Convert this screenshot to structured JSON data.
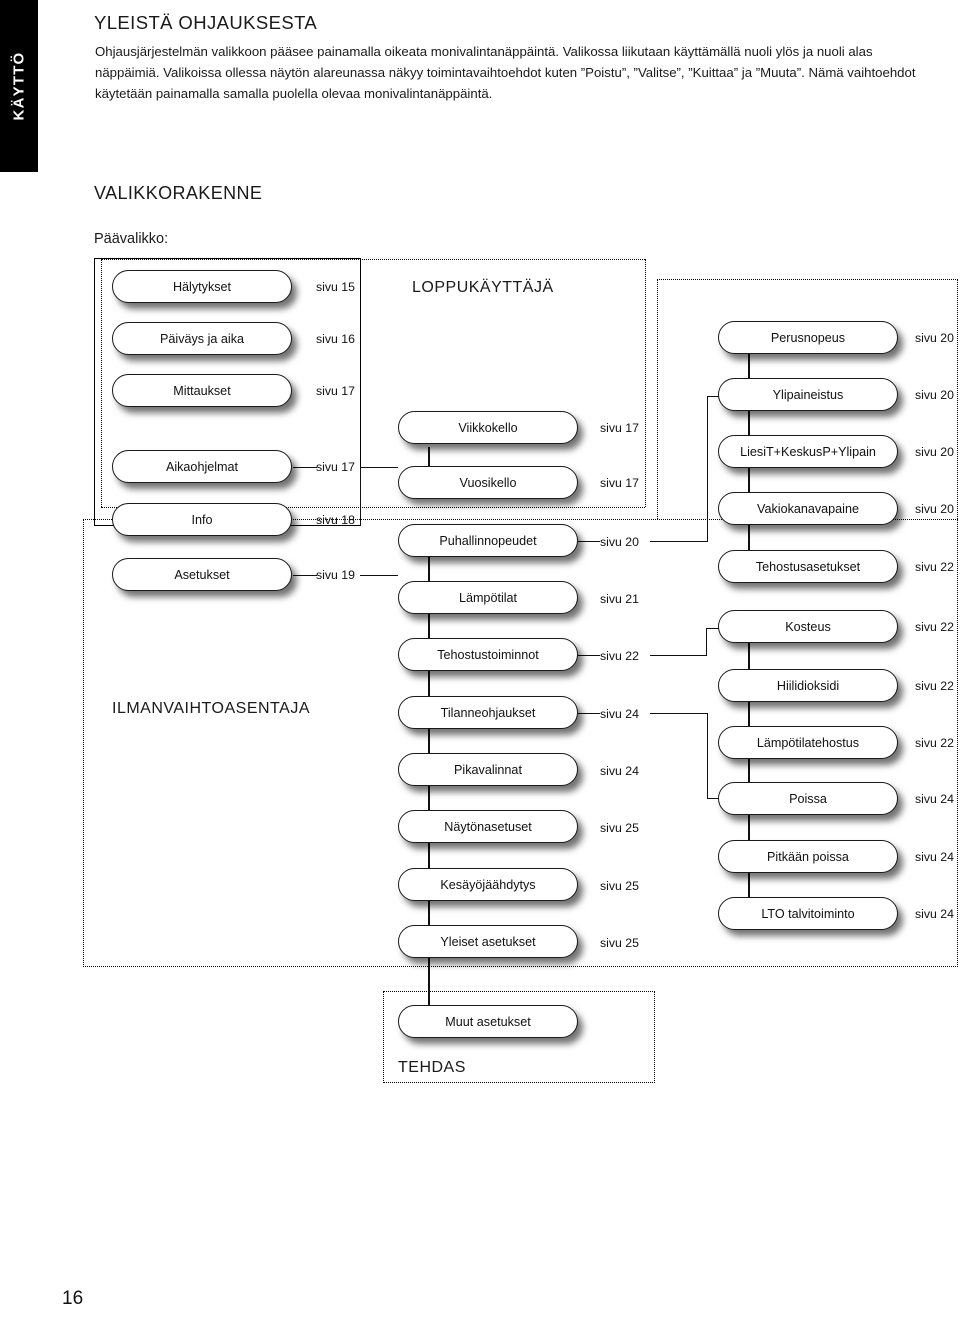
{
  "side_tab": {
    "label": "KÄYTTÖ"
  },
  "headings": {
    "section_title": "YLEISTÄ OHJAUKSESTA",
    "diagram_title": "VALIKKORAKENNE",
    "main_menu_label": "Päävalikko:"
  },
  "intro_paragraph": "Ohjausjärjestelmän valikkoon pääsee painamalla oikeata monivalintanäppäintä. Valikossa liikutaan käyttämällä nuoli ylös ja nuoli alas näppäimiä. Valikoissa ollessa näytön alareunassa näkyy toimintavaihtoehdot kuten ”Poistu”, ”Valitse”, ”Kuittaa” ja ”Muuta”. Nämä vaihtoehdot käytetään painamalla samalla puolella olevaa monivalintanäppäintä.",
  "zones": {
    "end_user": "LOPPUKÄYTTÄJÄ",
    "installer": "ILMANVAIHTOASENTAJA",
    "factory": "TEHDAS"
  },
  "page_number": "16",
  "diagram": {
    "column_main": [
      {
        "label": "Hälytykset",
        "page_ref": "sivu 15"
      },
      {
        "label": "Päiväys ja aika",
        "page_ref": "sivu 16"
      },
      {
        "label": "Mittaukset",
        "page_ref": "sivu 17"
      },
      {
        "label": "Aikaohjelmat",
        "page_ref": "sivu 17"
      },
      {
        "label": "Info",
        "page_ref": "sivu 18"
      },
      {
        "label": "Asetukset",
        "page_ref": "sivu 19"
      }
    ],
    "column_sub": [
      {
        "label": "Viikkokello",
        "page_ref": "sivu 17"
      },
      {
        "label": "Vuosikello",
        "page_ref": "sivu 17"
      },
      {
        "label": "Puhallinnopeudet",
        "page_ref": "sivu 20"
      },
      {
        "label": "Lämpötilat",
        "page_ref": "sivu 21"
      },
      {
        "label": "Tehostustoiminnot",
        "page_ref": "sivu 22"
      },
      {
        "label": "Tilanneohjaukset",
        "page_ref": "sivu 24"
      },
      {
        "label": "Pikavalinnat",
        "page_ref": "sivu 24"
      },
      {
        "label": "Näytönasetuset",
        "page_ref": "sivu 25"
      },
      {
        "label": "Kesäyöjäähdytys",
        "page_ref": "sivu 25"
      },
      {
        "label": "Yleiset asetukset",
        "page_ref": "sivu 25"
      }
    ],
    "column_detail": [
      {
        "label": "Perusnopeus",
        "page_ref": "sivu 20"
      },
      {
        "label": "Ylipaineistus",
        "page_ref": "sivu 20"
      },
      {
        "label": "LiesiT+KeskusP+Ylipain",
        "page_ref": "sivu 20"
      },
      {
        "label": "Vakiokanavapaine",
        "page_ref": "sivu 20"
      },
      {
        "label": "Tehostusasetukset",
        "page_ref": "sivu 22"
      },
      {
        "label": "Kosteus",
        "page_ref": "sivu 22"
      },
      {
        "label": "Hiilidioksidi",
        "page_ref": "sivu 22"
      },
      {
        "label": "Lämpötilatehostus",
        "page_ref": "sivu 22"
      },
      {
        "label": "Poissa",
        "page_ref": "sivu 24"
      },
      {
        "label": "Pitkään poissa",
        "page_ref": "sivu 24"
      },
      {
        "label": "LTO talvitoiminto",
        "page_ref": "sivu 24"
      }
    ],
    "column_factory": [
      {
        "label": "Muut asetukset",
        "page_ref": ""
      }
    ]
  },
  "colors": {
    "tab_background": "#000000",
    "tab_text": "#ffffff",
    "text": "#1a1a1a",
    "node_fill": "#ffffff",
    "node_border": "#1a1a1a"
  }
}
